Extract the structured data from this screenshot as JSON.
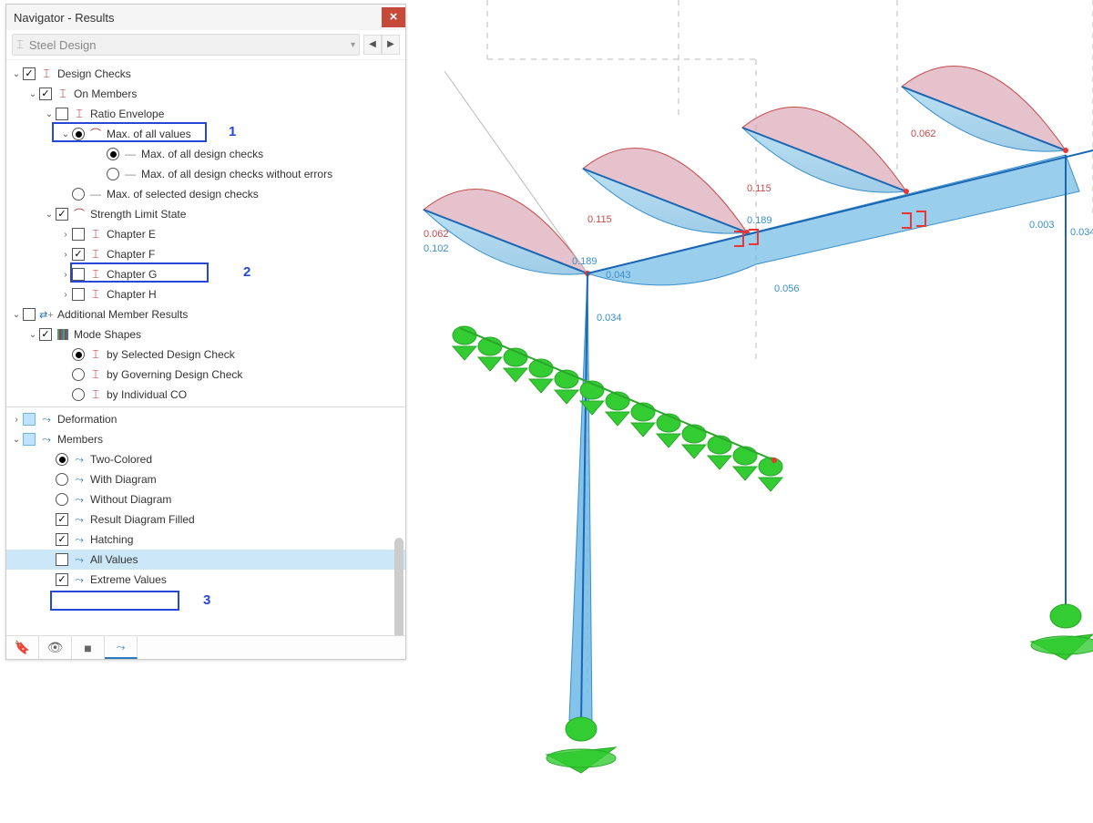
{
  "window": {
    "title": "Navigator - Results"
  },
  "combo": {
    "label": "Steel Design"
  },
  "annotations": {
    "num1": "1",
    "num2": "2",
    "num3": "3"
  },
  "tree": {
    "design_checks": "Design Checks",
    "on_members": "On Members",
    "ratio_envelope": "Ratio Envelope",
    "max_all_values": "Max. of all values",
    "max_all_dc": "Max. of all design checks",
    "max_all_dc_noerr": "Max. of all design checks without errors",
    "max_sel_dc": "Max. of selected design checks",
    "sls": "Strength Limit State",
    "ch_e": "Chapter E",
    "ch_f": "Chapter F",
    "ch_g": "Chapter G",
    "ch_h": "Chapter H",
    "add_member": "Additional Member Results",
    "mode_shapes": "Mode Shapes",
    "by_sel": "by Selected Design Check",
    "by_gov": "by Governing Design Check",
    "by_ind": "by Individual CO",
    "deformation": "Deformation",
    "members": "Members",
    "two_colored": "Two-Colored",
    "with_diag": "With Diagram",
    "without_diag": "Without Diagram",
    "result_filled": "Result Diagram Filled",
    "hatching": "Hatching",
    "all_values": "All Values",
    "extreme_values": "Extreme Values"
  },
  "viewport_labels": {
    "l0062a": "0.062",
    "l0102a": "0.102",
    "l0115a": "0.115",
    "l0189a": "0.189",
    "l0115b": "0.115",
    "l0189b": "0.189",
    "l0062b": "0.062",
    "l0043": "0.043",
    "l0034a": "0.034",
    "l0056": "0.056",
    "l0003": "0.003",
    "l0034b": "0.034"
  }
}
